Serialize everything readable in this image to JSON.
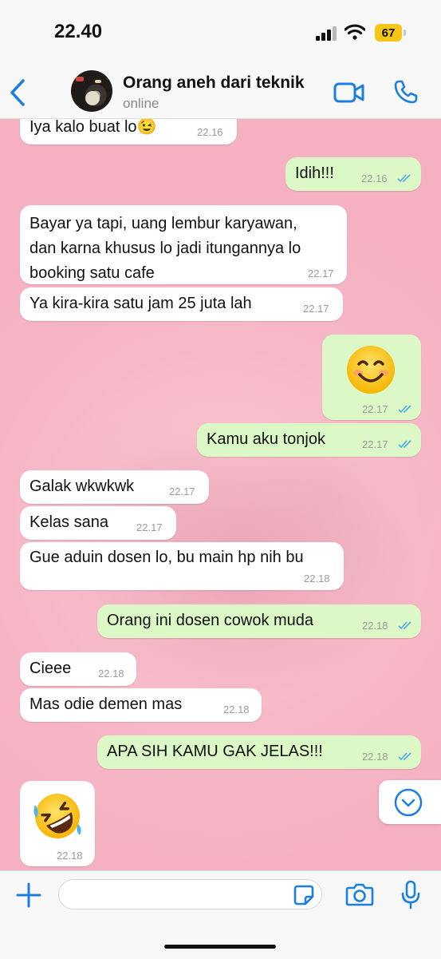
{
  "status_bar": {
    "time": "22.40",
    "battery": "67"
  },
  "header": {
    "name": "Orang aneh dari teknik",
    "status": "online"
  },
  "messages": [
    {
      "dir": "in",
      "text": "Iya kalo buat lo😉",
      "time": "22.16"
    },
    {
      "dir": "out",
      "text": "Idih!!!",
      "time": "22.16"
    },
    {
      "dir": "in",
      "text": "Bayar ya tapi, uang lembur karyawan,\ndan karna khusus lo jadi itungannya lo\nbooking satu cafe",
      "time": "22.17"
    },
    {
      "dir": "in",
      "text": "Ya kira-kira satu jam 25 juta lah",
      "time": "22.17"
    },
    {
      "dir": "out",
      "text": "😊",
      "time": "22.17"
    },
    {
      "dir": "out",
      "text": "Kamu aku tonjok",
      "time": "22.17"
    },
    {
      "dir": "in",
      "text": "Galak wkwkwk",
      "time": "22.17"
    },
    {
      "dir": "in",
      "text": "Kelas sana",
      "time": "22.17"
    },
    {
      "dir": "in",
      "text": "Gue aduin dosen lo, bu main hp nih bu",
      "time": "22.18"
    },
    {
      "dir": "out",
      "text": "Orang ini dosen cowok muda",
      "time": "22.18"
    },
    {
      "dir": "in",
      "text": "Cieee",
      "time": "22.18"
    },
    {
      "dir": "in",
      "text": "Mas odie demen mas",
      "time": "22.18"
    },
    {
      "dir": "out",
      "text": "APA SIH KAMU GAK JELAS!!!",
      "time": "22.18"
    },
    {
      "dir": "in",
      "text": "🤣",
      "time": "22.18"
    }
  ],
  "input": {
    "placeholder": ""
  },
  "colors": {
    "accent": "#1a7fe0",
    "outgoing": "#dcf8c6",
    "incoming": "#ffffff",
    "read_ticks": "#4fa8e8"
  },
  "icons": [
    "back-chevron-icon",
    "video-call-icon",
    "phone-icon",
    "scroll-down-icon",
    "plus-icon",
    "sticker-icon",
    "camera-icon",
    "microphone-icon"
  ]
}
